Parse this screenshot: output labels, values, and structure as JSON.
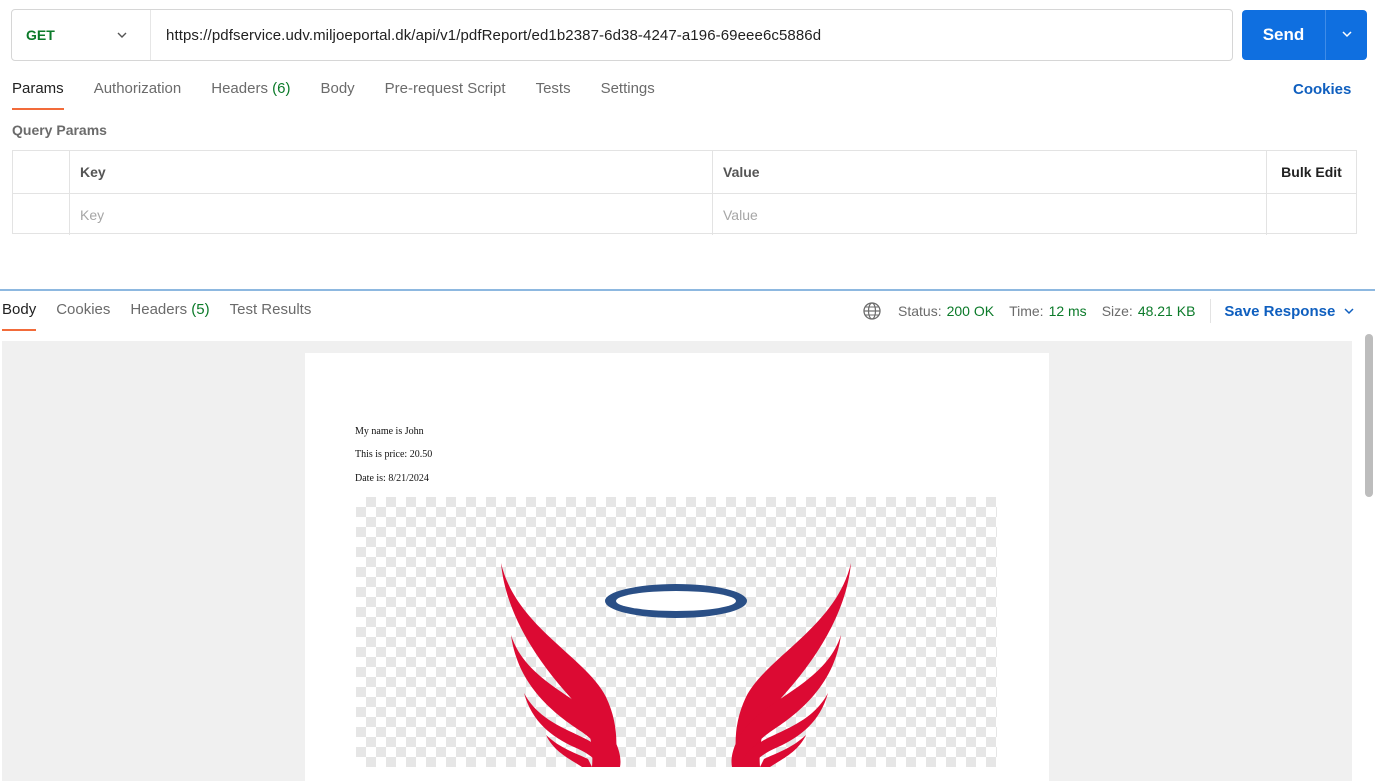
{
  "request": {
    "method": "GET",
    "url": "https://pdfservice.udv.miljoeportal.dk/api/v1/pdfReport/ed1b2387-6d38-4247-a196-69eee6c5886d",
    "send_label": "Send"
  },
  "request_tabs": [
    {
      "label": "Params",
      "active": true
    },
    {
      "label": "Authorization"
    },
    {
      "label": "Headers",
      "count": "(6)"
    },
    {
      "label": "Body"
    },
    {
      "label": "Pre-request Script"
    },
    {
      "label": "Tests"
    },
    {
      "label": "Settings"
    }
  ],
  "cookies_label": "Cookies",
  "query_params": {
    "title": "Query Params",
    "headers": {
      "key": "Key",
      "value": "Value",
      "bulk_edit": "Bulk Edit"
    },
    "placeholders": {
      "key": "Key",
      "value": "Value"
    }
  },
  "response_tabs": [
    {
      "label": "Body",
      "active": true
    },
    {
      "label": "Cookies"
    },
    {
      "label": "Headers",
      "count": "(5)"
    },
    {
      "label": "Test Results"
    }
  ],
  "status": {
    "status_label": "Status:",
    "status_value": "200 OK",
    "time_label": "Time:",
    "time_value": "12 ms",
    "size_label": "Size:",
    "size_value": "48.21 KB"
  },
  "save_response_label": "Save Response",
  "pdf": {
    "lines": [
      "My name is John",
      "This is price: 20.50",
      "Date is: 8/21/2024"
    ]
  },
  "colors": {
    "accent": "#0f6fe0",
    "method_green": "#0b7a29",
    "tab_underline": "#f26b3a",
    "link_blue": "#0f5fbf",
    "logo_red": "#dc0a33",
    "halo_blue": "#2a4f86"
  },
  "icons": [
    "chevron-down-icon",
    "globe-icon",
    "winged-halo-logo"
  ]
}
